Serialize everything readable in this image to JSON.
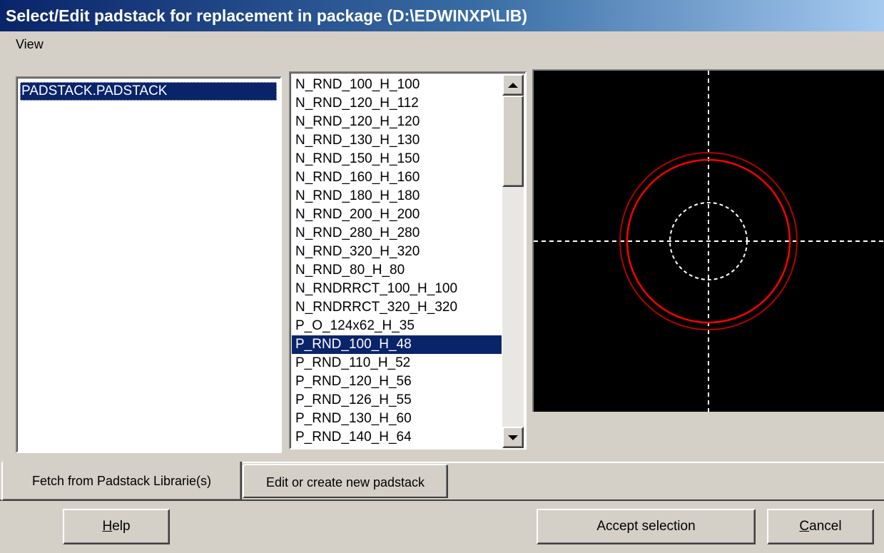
{
  "window": {
    "title": "Select/Edit padstack for replacement in package (D:\\EDWINXP\\LIB)"
  },
  "menu": {
    "items": [
      {
        "label": "View"
      }
    ]
  },
  "library_list": {
    "items": [
      {
        "label": "PADSTACK.PADSTACK",
        "selected": true
      }
    ]
  },
  "padstack_list": {
    "items": [
      "N_RND_100_H_100",
      "N_RND_120_H_112",
      "N_RND_120_H_120",
      "N_RND_130_H_130",
      "N_RND_150_H_150",
      "N_RND_160_H_160",
      "N_RND_180_H_180",
      "N_RND_200_H_200",
      "N_RND_280_H_280",
      "N_RND_320_H_320",
      "N_RND_80_H_80",
      "N_RNDRRCT_100_H_100",
      "N_RNDRRCT_320_H_320",
      "P_O_124x62_H_35",
      "P_RND_100_H_48",
      "P_RND_110_H_52",
      "P_RND_120_H_56",
      "P_RND_126_H_55",
      "P_RND_130_H_60",
      "P_RND_140_H_64"
    ],
    "selected": "P_RND_100_H_48"
  },
  "preview": {
    "background": "#000000",
    "pad_color": "#ff0000",
    "outline_color": "#b30000",
    "crosshair_color": "#ffffff"
  },
  "tabs": [
    {
      "label": "Fetch from Padstack Librarie(s)",
      "active": true
    },
    {
      "label": "Edit or create new padstack",
      "active": false
    }
  ],
  "buttons": {
    "help": {
      "first": "H",
      "rest": "elp"
    },
    "accept": {
      "label": "Accept selection"
    },
    "cancel": {
      "first": "C",
      "rest": "ancel"
    }
  }
}
